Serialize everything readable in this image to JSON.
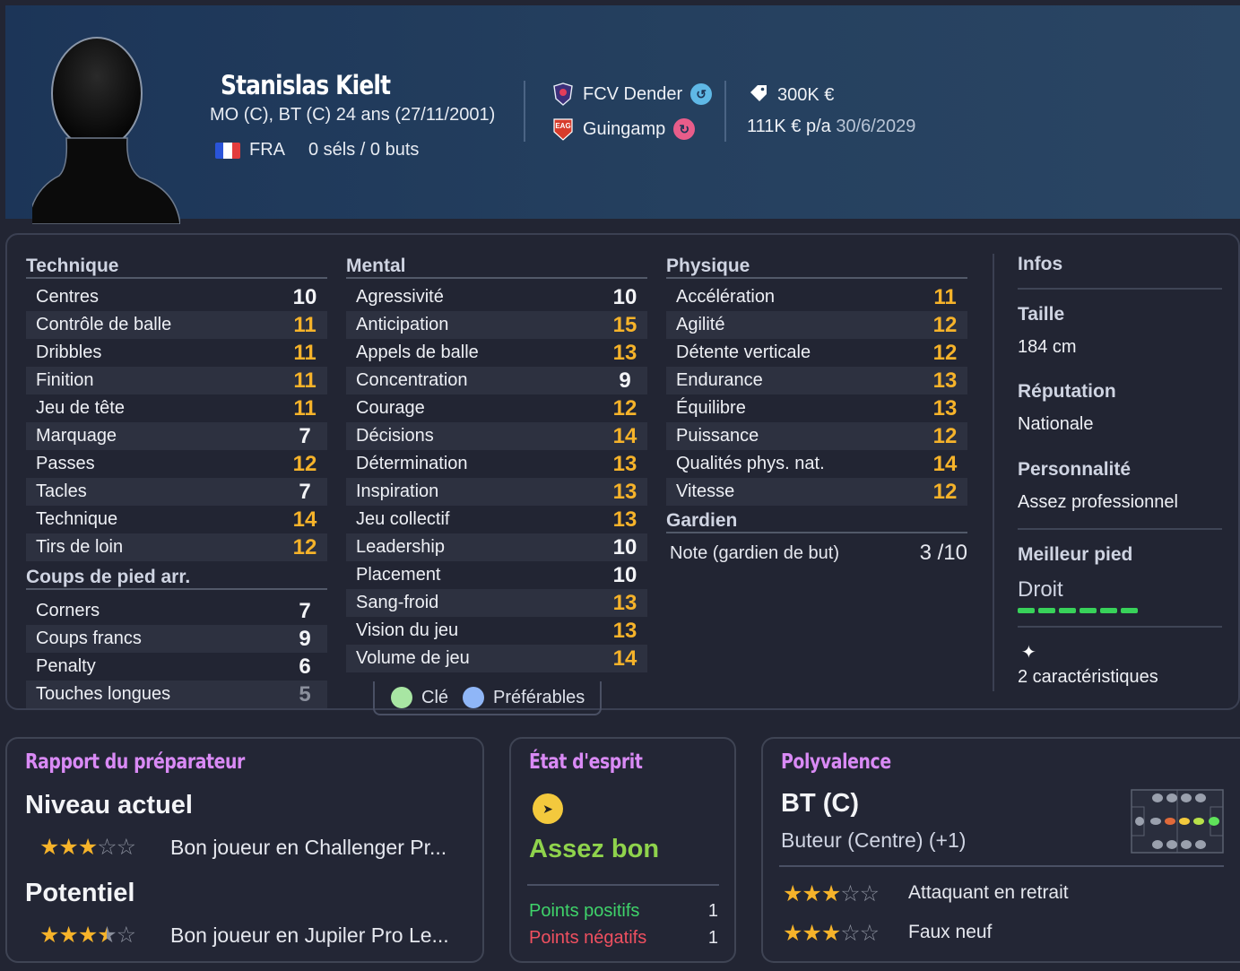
{
  "player": {
    "name": "Stanislas Kielt",
    "positions_age": "MO (C), BT (C)   24 ans (27/11/2001)",
    "nationality": "FRA",
    "caps": "0 séls / 0 buts",
    "clubs": [
      {
        "name": "FCV Dender",
        "icon": "loan-from-icon",
        "color": "#5fb8e6"
      },
      {
        "name": "Guingamp",
        "icon": "loan-to-icon",
        "color": "#e85d8a"
      }
    ],
    "value": "300K €",
    "wage": "111K € p/a",
    "contract": "30/6/2029"
  },
  "attributes": {
    "technique": {
      "title": "Technique",
      "items": [
        {
          "label": "Centres",
          "value": "10",
          "tone": "w"
        },
        {
          "label": "Contrôle de balle",
          "value": "11",
          "tone": "y"
        },
        {
          "label": "Dribbles",
          "value": "11",
          "tone": "y"
        },
        {
          "label": "Finition",
          "value": "11",
          "tone": "y"
        },
        {
          "label": "Jeu de tête",
          "value": "11",
          "tone": "y"
        },
        {
          "label": "Marquage",
          "value": "7",
          "tone": "w"
        },
        {
          "label": "Passes",
          "value": "12",
          "tone": "y"
        },
        {
          "label": "Tacles",
          "value": "7",
          "tone": "w"
        },
        {
          "label": "Technique",
          "value": "14",
          "tone": "y"
        },
        {
          "label": "Tirs de loin",
          "value": "12",
          "tone": "y"
        }
      ]
    },
    "set_pieces": {
      "title": "Coups de pied arr.",
      "items": [
        {
          "label": "Corners",
          "value": "7",
          "tone": "w"
        },
        {
          "label": "Coups francs",
          "value": "9",
          "tone": "w"
        },
        {
          "label": "Penalty",
          "value": "6",
          "tone": "w"
        },
        {
          "label": "Touches longues",
          "value": "5",
          "tone": "g"
        }
      ]
    },
    "mental": {
      "title": "Mental",
      "items": [
        {
          "label": "Agressivité",
          "value": "10",
          "tone": "w"
        },
        {
          "label": "Anticipation",
          "value": "15",
          "tone": "y"
        },
        {
          "label": "Appels de balle",
          "value": "13",
          "tone": "y"
        },
        {
          "label": "Concentration",
          "value": "9",
          "tone": "w"
        },
        {
          "label": "Courage",
          "value": "12",
          "tone": "y"
        },
        {
          "label": "Décisions",
          "value": "14",
          "tone": "y"
        },
        {
          "label": "Détermination",
          "value": "13",
          "tone": "y"
        },
        {
          "label": "Inspiration",
          "value": "13",
          "tone": "y"
        },
        {
          "label": "Jeu collectif",
          "value": "13",
          "tone": "y"
        },
        {
          "label": "Leadership",
          "value": "10",
          "tone": "w"
        },
        {
          "label": "Placement",
          "value": "10",
          "tone": "w"
        },
        {
          "label": "Sang-froid",
          "value": "13",
          "tone": "y"
        },
        {
          "label": "Vision du jeu",
          "value": "13",
          "tone": "y"
        },
        {
          "label": "Volume de jeu",
          "value": "14",
          "tone": "y"
        }
      ]
    },
    "physique": {
      "title": "Physique",
      "items": [
        {
          "label": "Accélération",
          "value": "11",
          "tone": "y"
        },
        {
          "label": "Agilité",
          "value": "12",
          "tone": "y"
        },
        {
          "label": "Détente verticale",
          "value": "12",
          "tone": "y"
        },
        {
          "label": "Endurance",
          "value": "13",
          "tone": "y"
        },
        {
          "label": "Équilibre",
          "value": "13",
          "tone": "y"
        },
        {
          "label": "Puissance",
          "value": "12",
          "tone": "y"
        },
        {
          "label": "Qualités phys. nat.",
          "value": "14",
          "tone": "y"
        },
        {
          "label": "Vitesse",
          "value": "12",
          "tone": "y"
        }
      ]
    },
    "goalkeeper": {
      "title": "Gardien",
      "label": "Note (gardien de but)",
      "value": "3 /10"
    }
  },
  "legend": {
    "key": "Clé",
    "preferred": "Préférables",
    "key_color": "#a8e6a3",
    "preferred_color": "#8fb6f7"
  },
  "infos": {
    "title": "Infos",
    "height_label": "Taille",
    "height": "184 cm",
    "reputation_label": "Réputation",
    "reputation": "Nationale",
    "personality_label": "Personnalité",
    "personality": "Assez professionnel",
    "foot_label": "Meilleur pied",
    "foot": "Droit",
    "foot_level": 1.0,
    "traits": "2 caractéristiques"
  },
  "coach_report": {
    "title": "Rapport du préparateur",
    "current_label": "Niveau actuel",
    "current_stars": 3,
    "current_desc": "Bon joueur en Challenger Pr...",
    "potential_label": "Potentiel",
    "potential_stars": 3.5,
    "potential_desc": "Bon joueur en Jupiler Pro Le..."
  },
  "mindset": {
    "title": "État d'esprit",
    "status": "Assez bon",
    "positive_label": "Points positifs",
    "positive": "1",
    "negative_label": "Points négatifs",
    "negative": "1"
  },
  "versatility": {
    "title": "Polyvalence",
    "position": "BT (C)",
    "role": "Buteur (Centre) (+1)",
    "roles": [
      {
        "name": "Attaquant en retrait",
        "stars": 3
      },
      {
        "name": "Faux neuf",
        "stars": 3
      }
    ]
  }
}
